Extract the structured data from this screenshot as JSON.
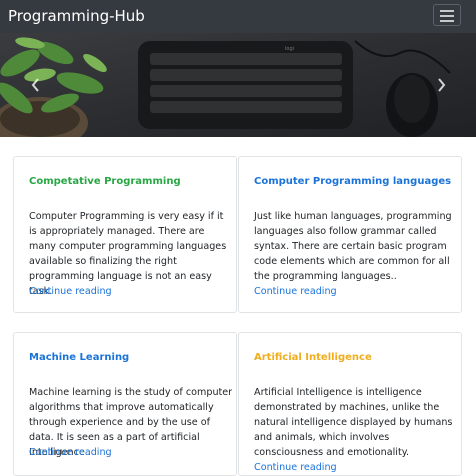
{
  "navbar": {
    "brand": "Programming-Hub"
  },
  "icons": {
    "menu": "hamburger-menu-icon",
    "prev": "chevron-left-icon",
    "next": "chevron-right-icon"
  },
  "colors": {
    "navbar_bg": "#343a40",
    "title_green": "#28a745",
    "title_blue": "#1a73d9",
    "title_orange": "#f0ad1e",
    "link": "#1a73d9"
  },
  "cards": [
    {
      "title": "Competative Programming",
      "text": "Computer Programming is very easy if it is appropriately managed. There are many computer programming languages available so finalizing the right programming language is not an easy task.",
      "link": "Continue reading"
    },
    {
      "title": "Computer Programming languages",
      "text": "Just like human languages, programming languages also follow grammar called syntax. There are certain basic program code elements which are common for all the programming languages..",
      "link": "Continue reading"
    },
    {
      "title": "Machine Learning",
      "text": "Machine learning is the study of computer algorithms that improve automatically through experience and by the use of data. It is seen as a part of artificial Intelligence .",
      "link": "Continue reading"
    },
    {
      "title": "Artificial Intelligence",
      "text": "Artificial Intelligence is intelligence demonstrated by machines, unlike the natural intelligence displayed by humans and animals, which involves consciousness and emotionality.",
      "link": "Continue reading"
    }
  ]
}
